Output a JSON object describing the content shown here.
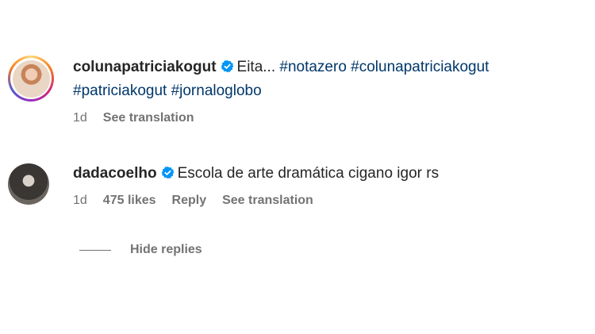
{
  "comments": [
    {
      "username": "colunapatriciakogut",
      "text_plain": "Eita...",
      "hashtags_line1": "#notazero #colunapatriciakogut",
      "hashtags_line2": "#patriciakogut #jornaloglobo",
      "time": "1d",
      "see_translation": "See translation"
    },
    {
      "username": "dadacoelho",
      "text": "Escola de arte dramática cigano igor rs",
      "time": "1d",
      "likes": "475 likes",
      "reply": "Reply",
      "see_translation": "See translation"
    }
  ],
  "hide_replies": "Hide replies",
  "colors": {
    "link": "#00376b",
    "muted": "#737373",
    "verified": "#0095f6"
  },
  "icons": {
    "verified": "verified-badge-icon"
  }
}
